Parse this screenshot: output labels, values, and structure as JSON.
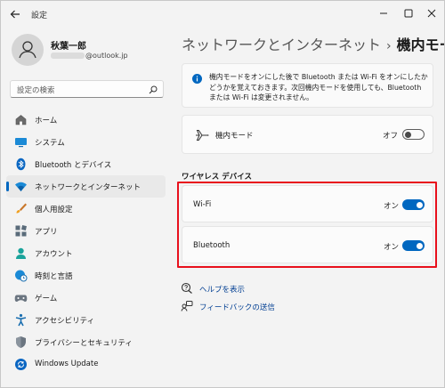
{
  "app": {
    "title": "設定"
  },
  "user": {
    "name": "秋葉一郎",
    "email_domain": "@outlook.jp"
  },
  "search": {
    "placeholder": "設定の検索"
  },
  "nav": {
    "items": [
      {
        "label": "ホーム",
        "icon": "home-icon",
        "selected": false
      },
      {
        "label": "システム",
        "icon": "monitor-icon",
        "selected": false
      },
      {
        "label": "Bluetooth とデバイス",
        "icon": "bluetooth-icon",
        "selected": false
      },
      {
        "label": "ネットワークとインターネット",
        "icon": "wifi-icon",
        "selected": true
      },
      {
        "label": "個人用設定",
        "icon": "brush-icon",
        "selected": false
      },
      {
        "label": "アプリ",
        "icon": "apps-icon",
        "selected": false
      },
      {
        "label": "アカウント",
        "icon": "account-icon",
        "selected": false
      },
      {
        "label": "時刻と言語",
        "icon": "clock-globe-icon",
        "selected": false
      },
      {
        "label": "ゲーム",
        "icon": "gamepad-icon",
        "selected": false
      },
      {
        "label": "アクセシビリティ",
        "icon": "accessibility-icon",
        "selected": false
      },
      {
        "label": "プライバシーとセキュリティ",
        "icon": "shield-icon",
        "selected": false
      },
      {
        "label": "Windows Update",
        "icon": "update-icon",
        "selected": false
      }
    ]
  },
  "breadcrumb": {
    "parent": "ネットワークとインターネット",
    "separator": "›",
    "current": "機内モード"
  },
  "info": {
    "text": "機内モードをオンにした後で Bluetooth または Wi-Fi をオンにしたかどうかを覚えておきます。次回機内モードを使用しても、Bluetooth または Wi-Fi は変更されません。"
  },
  "airplane": {
    "label": "機内モード",
    "state_label": "オフ",
    "on": false
  },
  "wireless": {
    "title": "ワイヤレス デバイス",
    "wifi": {
      "label": "Wi-Fi",
      "state_label": "オン",
      "on": true
    },
    "bluetooth": {
      "label": "Bluetooth",
      "state_label": "オン",
      "on": true
    }
  },
  "links": {
    "help": "ヘルプを表示",
    "feedback": "フィードバックの送信"
  },
  "colors": {
    "accent": "#0067c0",
    "highlight": "#e8101c"
  }
}
